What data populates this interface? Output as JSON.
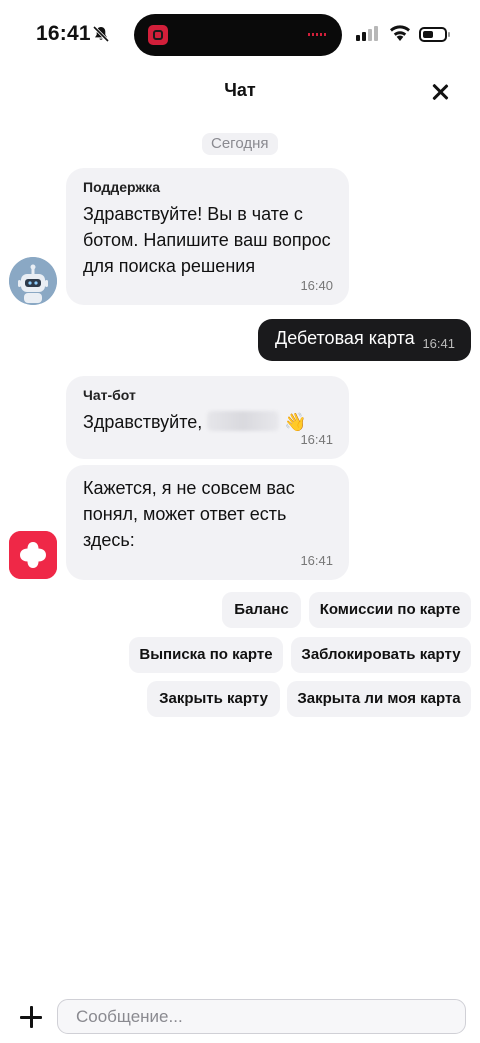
{
  "status_bar": {
    "time": "16:41"
  },
  "header": {
    "title": "Чат"
  },
  "date_divider": "Сегодня",
  "messages": [
    {
      "sender": "Поддержка",
      "lines": [
        "Здравствуйте! Вы в чате с",
        "ботом. Напишите ваш вопрос",
        "для поиска решения"
      ],
      "time": "16:40"
    },
    {
      "text": "Дебетовая карта",
      "time": "16:41"
    },
    {
      "sender": "Чат-бот",
      "text": "Здравствуйте,",
      "emoji": "👋",
      "time": "16:41"
    },
    {
      "lines": [
        "Кажется, я не совсем вас",
        "понял, может ответ есть",
        "здесь:"
      ],
      "time": "16:41"
    }
  ],
  "quick_replies": [
    "Баланс",
    "Комиссии по карте",
    "Выписка по карте",
    "Заблокировать карту",
    "Закрыть карту",
    "Закрыта ли моя карта"
  ],
  "composer": {
    "placeholder": "Сообщение..."
  },
  "colors": {
    "brand": "#EF2847",
    "bubble_in": "#F2F2F5",
    "bubble_out": "#1A1A1C"
  }
}
